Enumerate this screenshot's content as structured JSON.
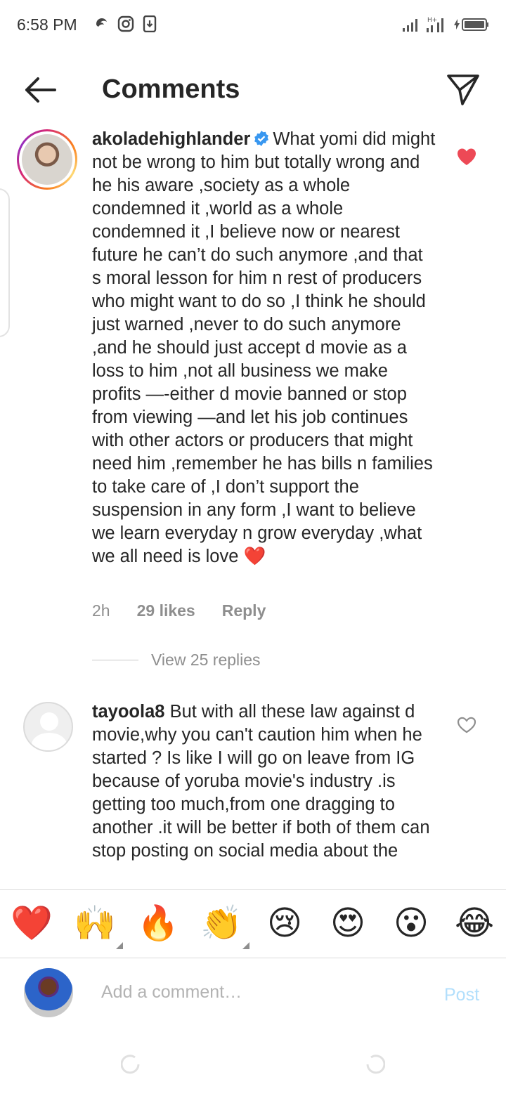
{
  "status_bar": {
    "time": "6:58 PM"
  },
  "header": {
    "title": "Comments"
  },
  "comments": [
    {
      "username": "akoladehighlander",
      "verified": true,
      "text": "What yomi did might not be wrong to him but totally wrong and he his aware ,society as a whole condemned it ,world as a whole condemned it ,I believe now or nearest future he can’t do such anymore ,and that s moral lesson for him n rest of producers who might want to do so ,I think he should just warned ,never to do such anymore ,and he should just accept d movie as a loss to him ,not all business we make profits —-either d movie banned or stop from viewing —and let his job continues with other actors or producers that might need him ,remember he has bills n families to take care of ,I don’t support the suspension in any form ,I want to believe we learn everyday n grow everyday ,what we all need is love",
      "trailing_emoji": "❤️",
      "liked": true,
      "time": "2h",
      "likes": "29 likes",
      "reply_label": "Reply",
      "view_replies": "View 25 replies"
    },
    {
      "username": "tayoola8",
      "verified": false,
      "text": "But with all these law against d  movie,why you can't caution him when he started ? Is like I will go on leave from IG because of yoruba movie's industry .is getting too much,from one dragging to another .it will be better if both of them can stop posting on social media about the",
      "liked": false
    }
  ],
  "emoji_bar": [
    "❤️",
    "🙌",
    "🔥",
    "👏",
    "😢",
    "😍",
    "😮",
    "😂"
  ],
  "composer": {
    "placeholder": "Add a comment…",
    "post_label": "Post"
  },
  "colors": {
    "like_red": "#ed4956",
    "post_blue_disabled": "#b2dffc",
    "meta_gray": "#8e8e8e",
    "verified_blue": "#3897f0"
  }
}
